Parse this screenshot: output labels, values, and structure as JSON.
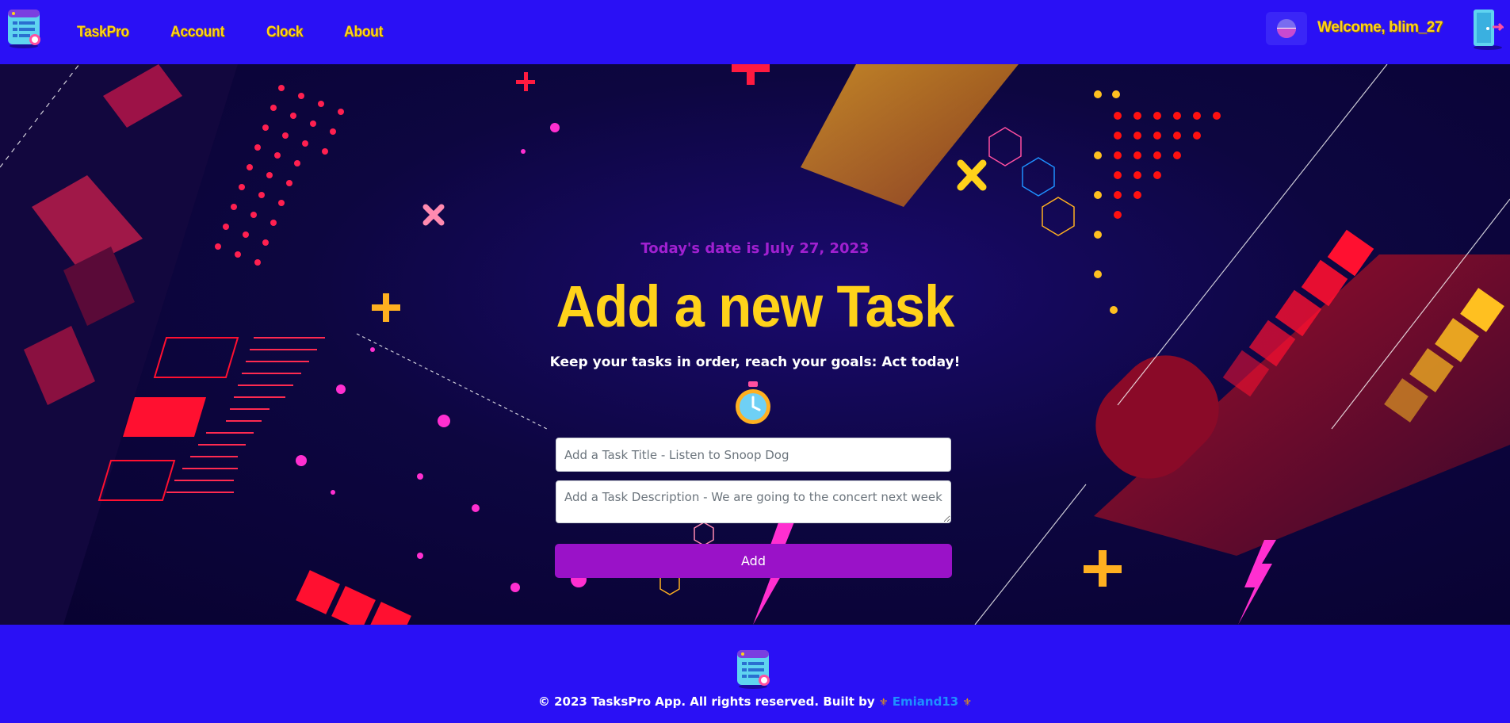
{
  "nav": {
    "links": [
      "TaskPro",
      "Account",
      "Clock",
      "About"
    ],
    "welcome": "Welcome, blim_27"
  },
  "hero": {
    "date_text": "Today's date is July 27, 2023",
    "title": "Add a new Task",
    "subtitle": "Keep your tasks in order, reach your goals: Act today!",
    "title_placeholder": "Add a Task Title - Listen to Snoop Dog",
    "description_placeholder": "Add a Task Description - We are going to the concert next week",
    "add_label": "Add"
  },
  "footer": {
    "copyright": "© 2023 TasksPro App. All rights reserved. Built by",
    "author": "Emiand13",
    "fleur": "⚜"
  },
  "colors": {
    "nav_bg": "#2a10f5",
    "accent_yellow": "#ffd21a",
    "button_purple": "#9a12c8",
    "date_purple": "#a020d0"
  },
  "icons": {
    "logo": "task-list-icon",
    "theme": "moon-toggle-icon",
    "logout": "door-exit-icon",
    "timer": "stopwatch-icon"
  }
}
